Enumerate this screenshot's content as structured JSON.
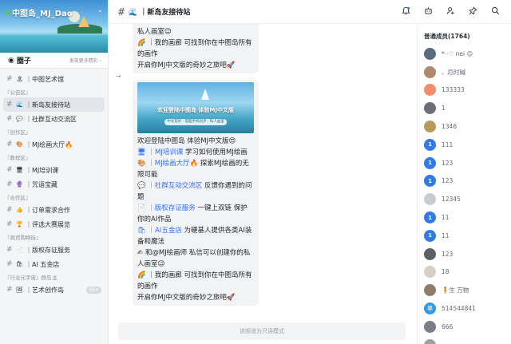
{
  "server": {
    "name": "中图岛_MJ_Dao"
  },
  "circle": {
    "label": "圈子",
    "more": "发现更多精彩 ›"
  },
  "channels": [
    {
      "type": "ch",
      "emoji": "🏝",
      "label": "｜中图艺术馆",
      "active": false
    },
    {
      "type": "cat",
      "label": "『公告区』"
    },
    {
      "type": "ch",
      "emoji": "🌊",
      "label": "｜新岛友接待站",
      "active": true
    },
    {
      "type": "ch",
      "emoji": "💬",
      "label": "｜社群互动交流区",
      "active": false
    },
    {
      "type": "cat",
      "label": "『创作区』"
    },
    {
      "type": "ch",
      "emoji": "🎨",
      "label": "｜MJ绘画大厅🔥",
      "active": false
    },
    {
      "type": "cat",
      "label": "『教程区』"
    },
    {
      "type": "ch",
      "emoji": "🖥",
      "label": "｜MJ培训课",
      "active": false
    },
    {
      "type": "ch",
      "emoji": "🔮",
      "label": "｜咒语宝藏",
      "active": false
    },
    {
      "type": "cat",
      "label": "『合作区』"
    },
    {
      "type": "ch",
      "emoji": "👍",
      "label": "｜订单需求合作",
      "active": false
    },
    {
      "type": "ch",
      "emoji": "🏆",
      "label": "｜评选大赛展览",
      "active": false
    },
    {
      "type": "cat",
      "label": "『商贸购物街』"
    },
    {
      "type": "ch",
      "emoji": "📄",
      "label": "｜版权存证服务",
      "active": false
    },
    {
      "type": "ch",
      "emoji": "🛍",
      "label": "｜AI 五金店",
      "active": false
    },
    {
      "type": "cat",
      "label": "『行业元宇宙』群岛🏝"
    },
    {
      "type": "ch",
      "emoji": "🖼",
      "label": "｜艺术创作岛",
      "active": false,
      "badge": "99+"
    }
  ],
  "topbar": {
    "title": "🌊 ｜新岛友接待站"
  },
  "chat": {
    "bubble1": [
      "私人画室😉",
      "🌈 ｜我的画廊 可找到你在中图岛所有的画作",
      "开启你MJ中文版的奇妙之旅吧🚀"
    ],
    "poster": {
      "title": "欢迎登陆中图岛 体验MJ中文版",
      "subtitle": "中文友好 · 电脑手机同步 · 私人画室"
    },
    "bubble2": {
      "welcome": "欢迎登陆中图岛 体验MJ中文版😍",
      "l1_link": "🖥 ｜MJ培训课",
      "l1_text": " 学习如何使用MJ绘画",
      "l2_link": "🎨 ｜MJ绘画大厅🔥",
      "l2_text": " 探索MJ绘画的无限可能",
      "l3_link": "💬 ｜社群互动交流区",
      "l3_text": " 反馈你遇到的问题",
      "l4_link": "📄 ｜版权存证服务",
      "l4_text": " 一键上双链 保护你的AI作品",
      "l5_link": "🛍 ｜AI五金店",
      "l5_text": " 为硬基人提供各类AI装备和魔法",
      "l6": "✍ 和@MJ绘画师 私信可以创建你的私人画室😉",
      "l7": "🌈 ｜我的画廊 可找到你在中图岛所有的画作",
      "l8": "开启你MJ中文版的奇妙之旅吧🚀"
    },
    "footer": "该频道为只读模式"
  },
  "members": {
    "header": "普通成员(1764)",
    "list": [
      {
        "name": "*··♡ nei 😊",
        "color": "#5a6b7d",
        "initial": ""
      },
      {
        "name": "、厄时碱",
        "color": "#b08a6a",
        "initial": ""
      },
      {
        "name": "133333",
        "color": "#f28c6b",
        "initial": ""
      },
      {
        "name": "1",
        "color": "#6b6f75",
        "initial": ""
      },
      {
        "name": "1346",
        "color": "#b89a5a",
        "initial": ""
      },
      {
        "name": "111",
        "color": "#2f7bea",
        "initial": "1"
      },
      {
        "name": "123",
        "color": "#2f7bea",
        "initial": "1"
      },
      {
        "name": "123",
        "color": "#2f7bea",
        "initial": "1"
      },
      {
        "name": "12345",
        "color": "#c9ccd1",
        "initial": ""
      },
      {
        "name": "11",
        "color": "#2f7bea",
        "initial": "1"
      },
      {
        "name": "11",
        "color": "#2f7bea",
        "initial": "1"
      },
      {
        "name": "123",
        "color": "#5b5f66",
        "initial": ""
      },
      {
        "name": "18",
        "color": "#d8cfc4",
        "initial": ""
      },
      {
        "name": "🧍生 万物",
        "color": "#8e7b6a",
        "initial": ""
      },
      {
        "name": "514544841",
        "color": "#2f9bea",
        "initial": "平"
      },
      {
        "name": "666",
        "color": "#7a7f86",
        "initial": ""
      },
      {
        "name": "",
        "color": "#9aa0a8",
        "initial": ""
      }
    ]
  }
}
